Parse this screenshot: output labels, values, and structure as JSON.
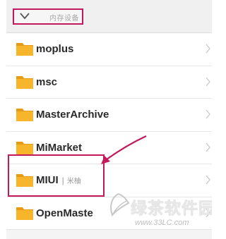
{
  "breadcrumb": {
    "label": "内存设备",
    "icon": "chevron-down-icon"
  },
  "folders": [
    {
      "name": "moplus"
    },
    {
      "name": "msc"
    },
    {
      "name": "MasterArchive"
    },
    {
      "name": "MiMarket"
    },
    {
      "name": "MIUI",
      "separator": "|",
      "tag": "米柚"
    },
    {
      "name": "OpenMaste"
    }
  ],
  "watermark": {
    "title": "绿茶软件园",
    "url": "www.33LC.com"
  },
  "colors": {
    "accent": "#c3185b",
    "folder": "#f7b52c",
    "folder_tab": "#e59b14"
  }
}
